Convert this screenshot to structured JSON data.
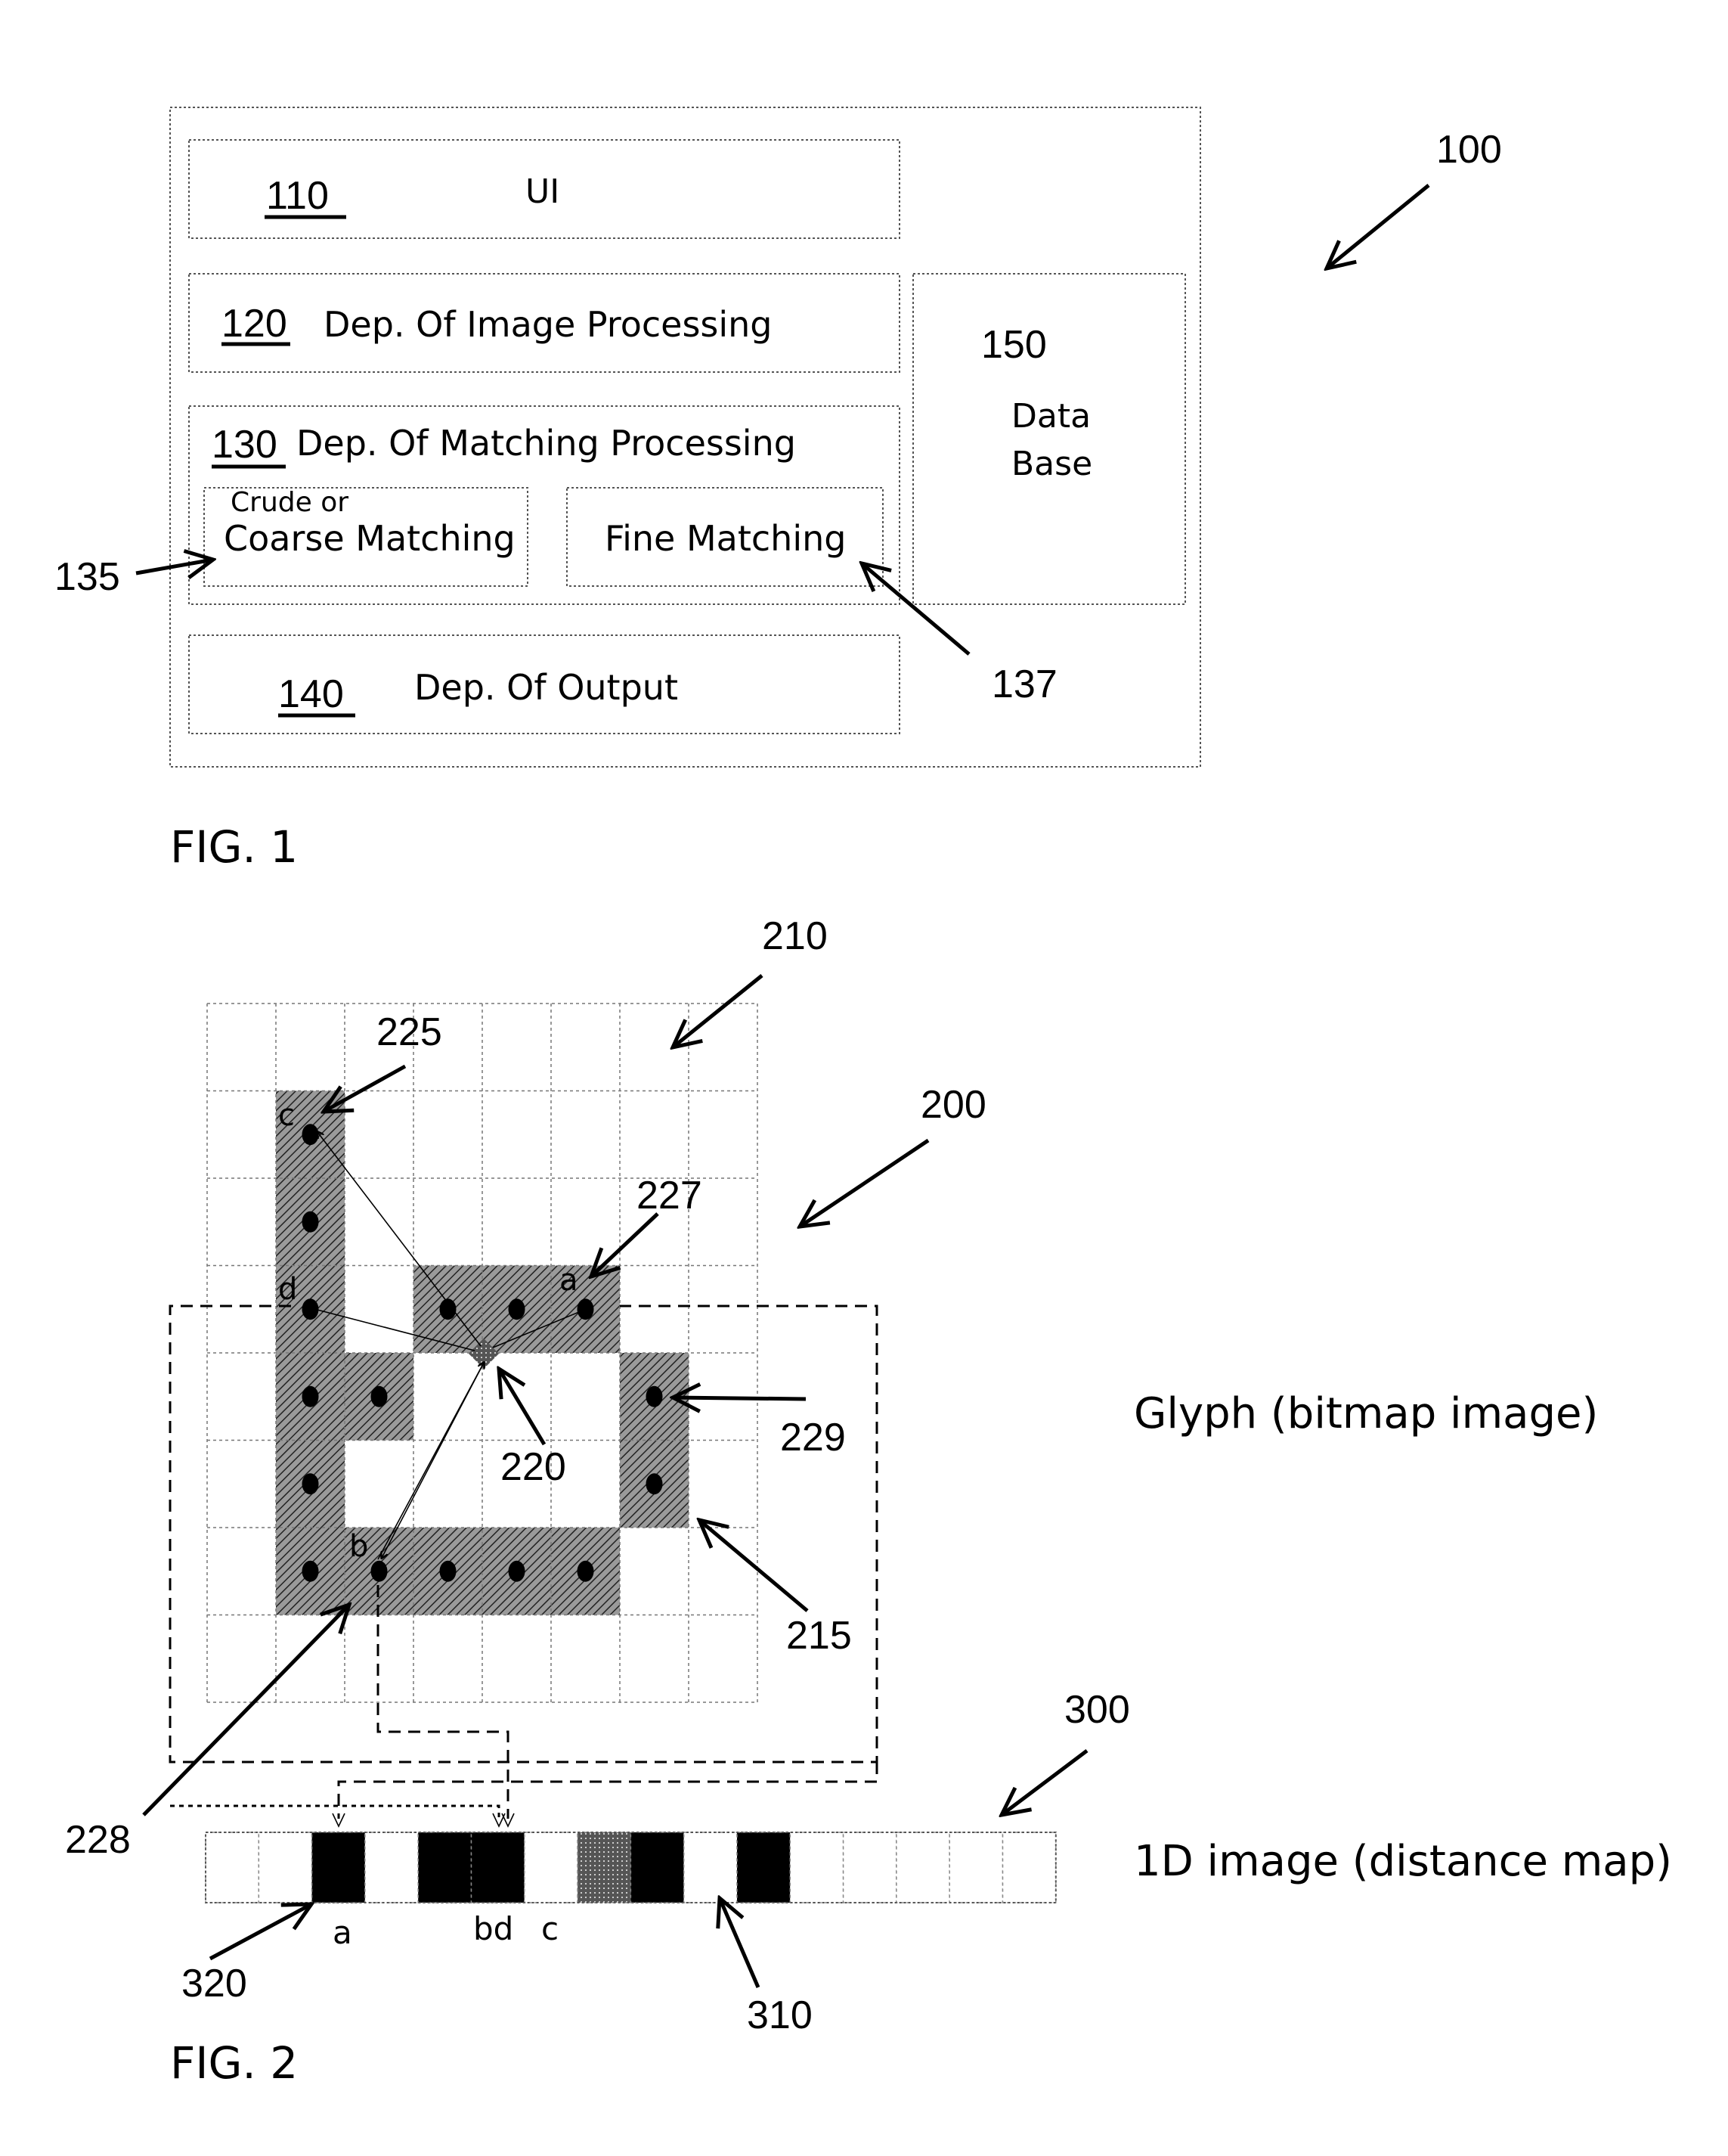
{
  "fig1": {
    "ref": "100",
    "caption": "FIG. 1",
    "blocks": [
      {
        "num": "110",
        "label": "UI"
      },
      {
        "num": "120",
        "label": "Dep. Of Image Processing"
      },
      {
        "num": "130",
        "label": "Dep. Of Matching Processing"
      },
      {
        "num": "140",
        "label": "Dep. Of Output"
      }
    ],
    "database": {
      "num": "150",
      "line1": "Data",
      "line2": "Base"
    },
    "coarse": {
      "line1": "Crude or",
      "line2": "Coarse Matching",
      "ref": "135"
    },
    "fine": {
      "label": "Fine Matching",
      "ref": "137"
    }
  },
  "fig2": {
    "caption": "FIG. 2",
    "refs": {
      "glyph_grid": "210",
      "glyph": "200",
      "point_c": "225",
      "point_a": "227",
      "center": "220",
      "stroke_right": "229",
      "pixel": "215",
      "point_b": "228",
      "strip": "300",
      "strip_cell": "310",
      "strip_black": "320"
    },
    "glyph_title": "Glyph (bitmap image)",
    "strip_title": "1D image (distance map)",
    "point_letters": {
      "a": "a",
      "b": "b",
      "c": "c",
      "d": "d"
    },
    "strip_letters": {
      "a": "a",
      "bd": "bd",
      "c": "c"
    },
    "grid": {
      "cols": 8,
      "rows": 8,
      "filled": [
        [
          1,
          1
        ],
        [
          1,
          2
        ],
        [
          1,
          3
        ],
        [
          3,
          3
        ],
        [
          4,
          3
        ],
        [
          5,
          3
        ],
        [
          1,
          4
        ],
        [
          2,
          4
        ],
        [
          6,
          4
        ],
        [
          1,
          5
        ],
        [
          6,
          5
        ],
        [
          1,
          6
        ],
        [
          2,
          6
        ],
        [
          3,
          6
        ],
        [
          4,
          6
        ],
        [
          5,
          6
        ]
      ],
      "dots": [
        [
          1,
          1
        ],
        [
          1,
          2
        ],
        [
          1,
          3
        ],
        [
          3,
          3
        ],
        [
          4,
          3
        ],
        [
          5,
          3
        ],
        [
          1,
          4
        ],
        [
          2,
          4
        ],
        [
          6,
          4
        ],
        [
          1,
          5
        ],
        [
          6,
          5
        ],
        [
          1,
          6
        ],
        [
          2,
          6
        ],
        [
          3,
          6
        ],
        [
          4,
          6
        ],
        [
          5,
          6
        ]
      ]
    },
    "strip_cells": [
      "white",
      "white",
      "black",
      "white",
      "black",
      "black",
      "white",
      "gray",
      "black",
      "white",
      "black",
      "white",
      "white",
      "white",
      "white",
      "white"
    ]
  }
}
